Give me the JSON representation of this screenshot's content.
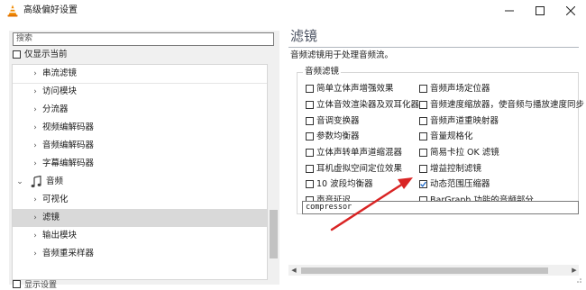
{
  "window": {
    "title": "高级偏好设置",
    "controls": {
      "minimize": "—",
      "maximize": "☐",
      "close": "✕"
    },
    "app_icon": "vlc-cone-icon"
  },
  "left": {
    "search_placeholder": "搜索",
    "only_current_label": "仅显示当前",
    "only_current_checked": false,
    "tree": [
      {
        "label": "串流滤镜",
        "chevron": "›"
      },
      {
        "label": "访问模块",
        "chevron": "›"
      },
      {
        "label": "分流器",
        "chevron": "›"
      },
      {
        "label": "视频编解码器",
        "chevron": "›"
      },
      {
        "label": "音频编解码器",
        "chevron": "›"
      },
      {
        "label": "字幕编解码器",
        "chevron": "›"
      },
      {
        "label": "音频",
        "chevron": "⌄"
      },
      {
        "label": "可视化",
        "chevron": "›"
      },
      {
        "label": "滤镜",
        "chevron": "›",
        "selected": true
      },
      {
        "label": "输出模块",
        "chevron": "›"
      },
      {
        "label": "音频重采样器",
        "chevron": "›"
      }
    ],
    "bottom_text": "显示设置"
  },
  "right": {
    "title": "滤镜",
    "description": "音频滤镜用于处理音频流。",
    "group_label": "音频滤镜",
    "filters_left": [
      {
        "label": "简单立体声增强效果",
        "checked": false
      },
      {
        "label": "立体音效渲染器及双耳化器",
        "checked": false
      },
      {
        "label": "音调变换器",
        "checked": false
      },
      {
        "label": "参数均衡器",
        "checked": false
      },
      {
        "label": "立体声转单声道缩混器",
        "checked": false
      },
      {
        "label": "耳机虚拟空间定位效果",
        "checked": false
      },
      {
        "label": "10 波段均衡器",
        "checked": false
      },
      {
        "label": "声音延迟",
        "checked": false
      }
    ],
    "filters_right": [
      {
        "label": "音频声场定位器",
        "checked": false
      },
      {
        "label": "音频速度缩放器，使音频与播放速度同步",
        "checked": false
      },
      {
        "label": "音频声道重映射器",
        "checked": false
      },
      {
        "label": "音量规格化",
        "checked": false
      },
      {
        "label": "简易卡拉 OK 滤镜",
        "checked": false
      },
      {
        "label": "增益控制滤镜",
        "checked": false
      },
      {
        "label": "动态范围压缩器",
        "checked": true
      },
      {
        "label": "BarGraph 功能的音频部分",
        "checked": false
      }
    ],
    "filter_value": "compressor"
  },
  "colors": {
    "annotation_arrow": "#d92424",
    "selected_row": "#d9d9d9",
    "check_mark": "#1a66c8"
  }
}
